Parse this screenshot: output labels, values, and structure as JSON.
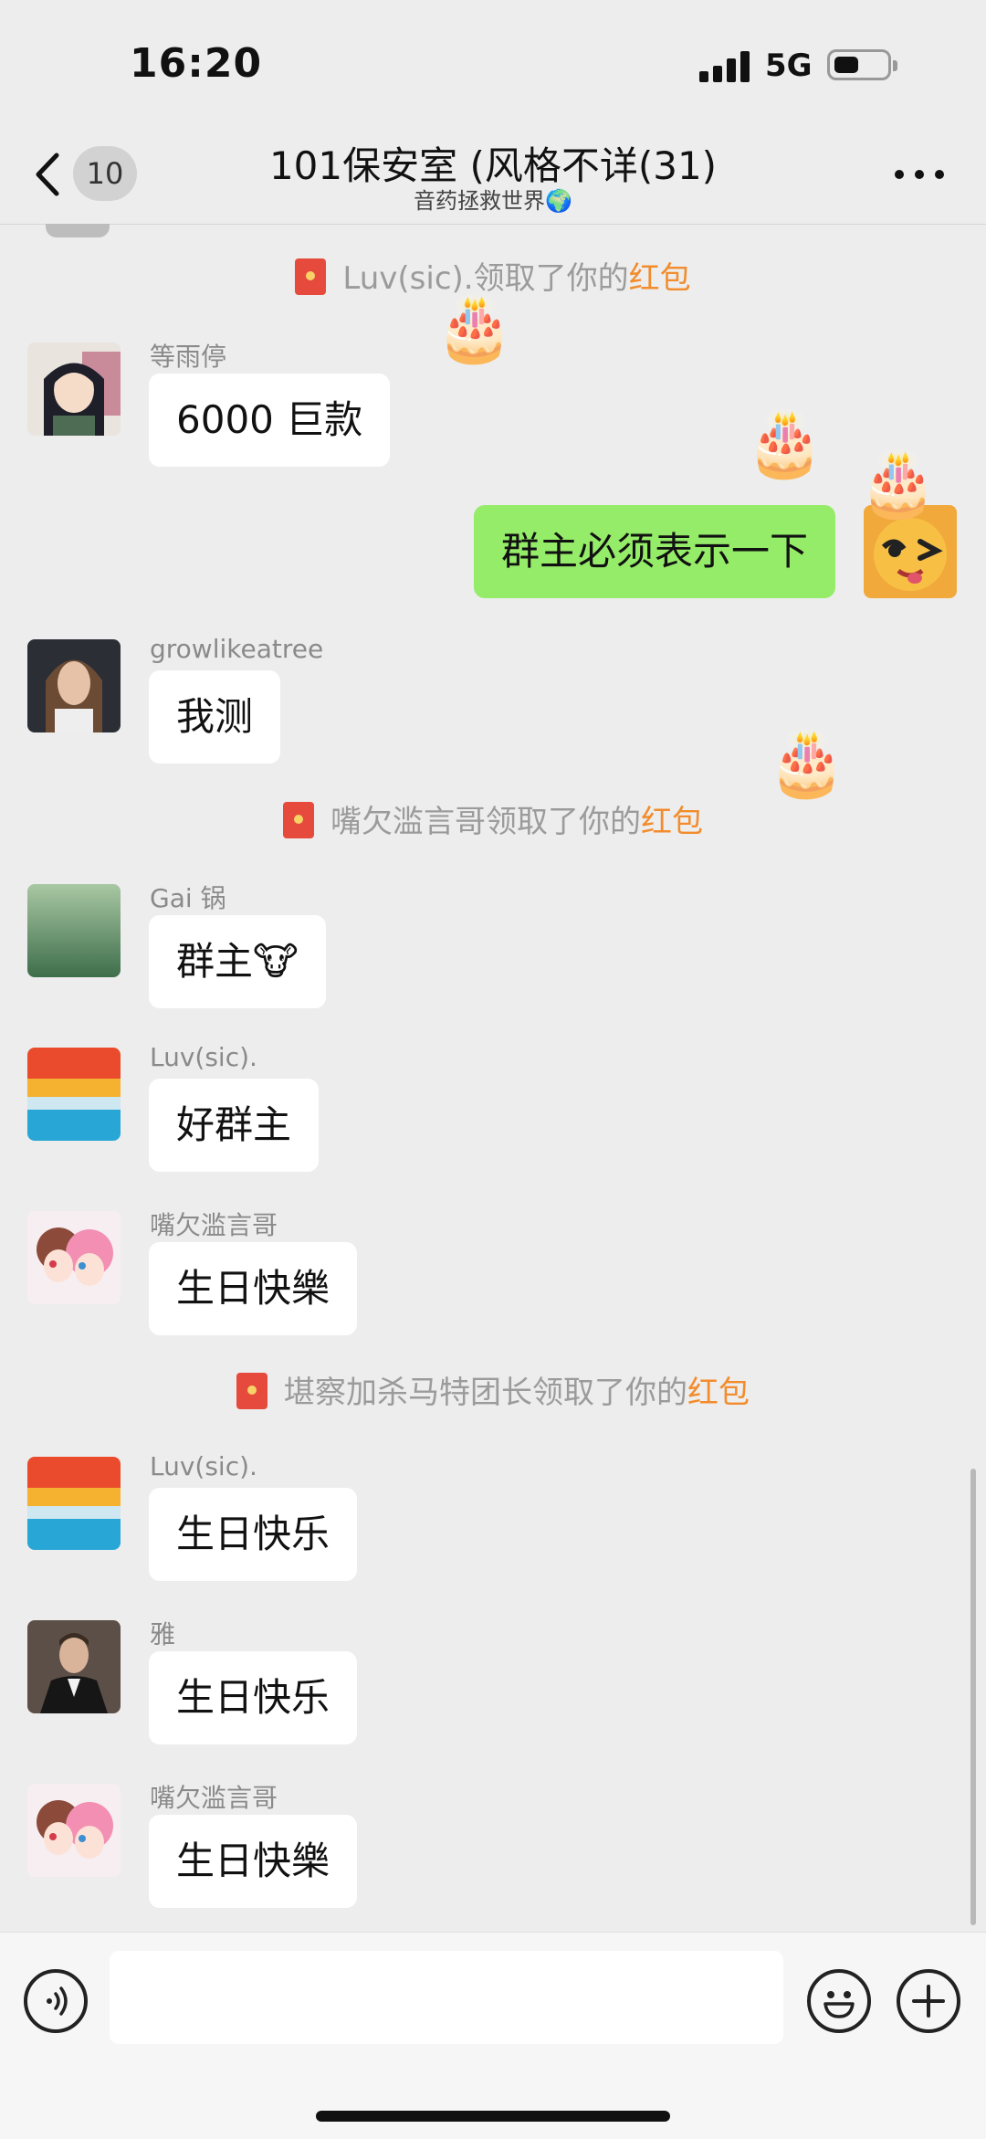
{
  "status_bar": {
    "time": "16:20",
    "network": "5G"
  },
  "header": {
    "back_count": "10",
    "title": "101保安室 (风格不详(31)",
    "subtitle": "音药拯救世界🌍"
  },
  "messages": [
    {
      "kind": "system",
      "prefix": "Luv(sic).领取了你的",
      "highlight": "红包"
    },
    {
      "kind": "chat",
      "sender": "等雨停",
      "text": "6000 巨款",
      "avatar": "anime-girl-avatar"
    },
    {
      "kind": "own",
      "text": "群主必须表示一下",
      "avatar": "winking-face-avatar"
    },
    {
      "kind": "chat",
      "sender": "growlikeatree",
      "text": "我测",
      "avatar": "woman-photo-avatar"
    },
    {
      "kind": "system",
      "prefix": "嘴欠滥言哥领取了你的",
      "highlight": "红包"
    },
    {
      "kind": "chat",
      "sender": "Gai 锅",
      "text": "群主🐮",
      "avatar": "green-gradient-avatar"
    },
    {
      "kind": "chat",
      "sender": "Luv(sic).",
      "text": "好群主",
      "avatar": "sunset-avatar"
    },
    {
      "kind": "chat",
      "sender": "嘴欠滥言哥",
      "text": "生日快樂",
      "avatar": "pink-anime-avatar"
    },
    {
      "kind": "system",
      "prefix": "堪察加杀马特团长领取了你的",
      "highlight": "红包"
    },
    {
      "kind": "chat",
      "sender": "Luv(sic).",
      "text": "生日快乐",
      "avatar": "sunset-avatar"
    },
    {
      "kind": "chat",
      "sender": "雅",
      "text": "生日快乐",
      "avatar": "man-suit-avatar"
    },
    {
      "kind": "chat",
      "sender": "嘴欠滥言哥",
      "text": "生日快樂",
      "avatar": "pink-anime-avatar"
    }
  ],
  "decorations": {
    "cake": "🎂"
  },
  "input_bar": {
    "voice_icon": "voice-icon",
    "emoji_icon": "emoji-icon",
    "plus_icon": "plus-icon"
  }
}
